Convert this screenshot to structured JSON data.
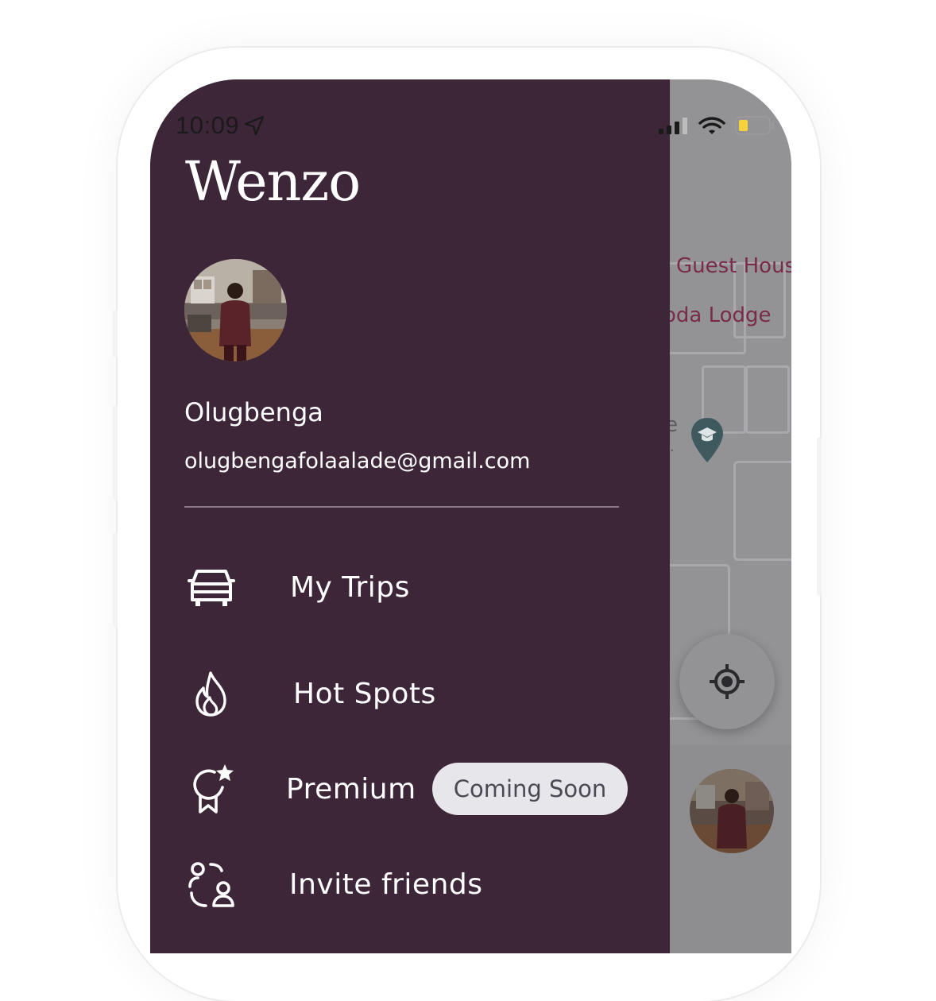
{
  "status_bar": {
    "time": "10:09",
    "location_icon": "location-arrow-icon",
    "signal_icon": "cellular-signal-icon",
    "wifi_icon": "wifi-icon",
    "battery_icon": "battery-low-icon",
    "battery_color": "#f6d33c"
  },
  "app": {
    "logo": "Wenzo",
    "drawer_color": "#3e2639"
  },
  "profile": {
    "name": "Olugbenga",
    "email": "olugbengafolaalade@gmail.com"
  },
  "menu": {
    "my_trips": {
      "label": "My Trips",
      "icon": "car-icon"
    },
    "hot_spots": {
      "label": "Hot Spots",
      "icon": "flame-icon"
    },
    "premium": {
      "label": "Premium",
      "icon": "award-star-icon",
      "badge": "Coming Soon"
    },
    "invite": {
      "label": "Invite friends",
      "icon": "invite-users-icon"
    }
  },
  "map": {
    "label_1": "Guest Hous",
    "label_2": "oda Lodge",
    "label_3": "e",
    "label_4": "..",
    "pin_icon": "school-pin-icon",
    "locate_icon": "crosshair-locate-icon"
  }
}
